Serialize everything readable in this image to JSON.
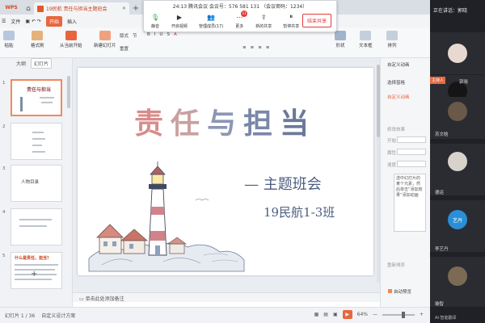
{
  "window": {
    "app_name": "WPS",
    "document_tab": "19民航 责任与担当主题班会",
    "new_tab": "+",
    "win_buttons": [
      "—",
      "□",
      "✕"
    ]
  },
  "menu": {
    "file": "文件",
    "start": "开始",
    "insert": "插入"
  },
  "ribbon": {
    "paste": "粘贴",
    "format_brush": "格式刷",
    "play_from_current": "从当前开始",
    "new_slide": "新建幻灯片",
    "layout": "版式",
    "section": "节",
    "reset": "重置",
    "new_share": "新的共享",
    "pause_share": "暂停共享",
    "shape": "形状",
    "textbox": "文本框",
    "arrange": "排列"
  },
  "meeting": {
    "info": "24:13  腾讯会议  会议号：576 581 131  （会议密码：1234）",
    "buttons": [
      {
        "label": "静音"
      },
      {
        "label": "开启视频"
      },
      {
        "label": "管理成员(17)"
      },
      {
        "label": "更多",
        "badge": "11"
      },
      {
        "label": "新的共享"
      },
      {
        "label": "暂停共享"
      }
    ],
    "end": "结束共享"
  },
  "left_panel": {
    "tab_outline": "大纲",
    "tab_slides": "幻灯片",
    "thumbs": [
      {
        "num": "1",
        "title": "责任与担当",
        "selected": true
      },
      {
        "num": "2",
        "title": "",
        "selected": false
      },
      {
        "num": "3",
        "title": "人物目录",
        "selected": false
      },
      {
        "num": "4",
        "title": "",
        "selected": false
      },
      {
        "num": "5",
        "title": "什么是责任，担当？",
        "selected": false
      }
    ],
    "add": "+"
  },
  "slide": {
    "title_chars": [
      "责",
      "任",
      "与",
      "担",
      "当"
    ],
    "title_colors": [
      "#d98b8b",
      "#c9a0a0",
      "#8d96b4",
      "#7a87a8",
      "#6b7999"
    ],
    "subtitle": "— 主题班会",
    "class_name": "19民航1-3班"
  },
  "notes": {
    "placeholder": "单击此处添加备注"
  },
  "right_panel": {
    "custom_animation": "自定义动画",
    "select_pane": "选择窗格",
    "custom_anim_btn": "自定义动画",
    "modify_effect": "修改效果",
    "start": "开始",
    "property": "属性",
    "speed": "速度",
    "hint": "选中幻灯片的某个元素，然后单击“添加效果”添加动画",
    "reorder": "重新排序",
    "autopreview": "自动预览"
  },
  "video": {
    "speaking": "正在讲话：郭晓",
    "participants": [
      {
        "name": "",
        "host": false,
        "avatar_color": "#e8d9d0"
      },
      {
        "name": "郭晓",
        "host": true,
        "avatar_color": "#151515"
      },
      {
        "name": "苏文晗",
        "host": false,
        "avatar_color": "#6a5848"
      },
      {
        "name": "德运",
        "host": false,
        "avatar_color": "#d8d2cc"
      },
      {
        "name": "李艺丹",
        "host": false,
        "avatar_color": "#2a8fd6",
        "avatar_text": "艺丹"
      },
      {
        "name": "璇智",
        "host": false,
        "avatar_color": "#7d6a55"
      }
    ],
    "bottom": "AI·智能翻译"
  },
  "status": {
    "slide_count": "幻灯片 1 / 36",
    "theme": "自定义设计方案",
    "zoom": "64%",
    "minus": "—",
    "plus": "+"
  }
}
